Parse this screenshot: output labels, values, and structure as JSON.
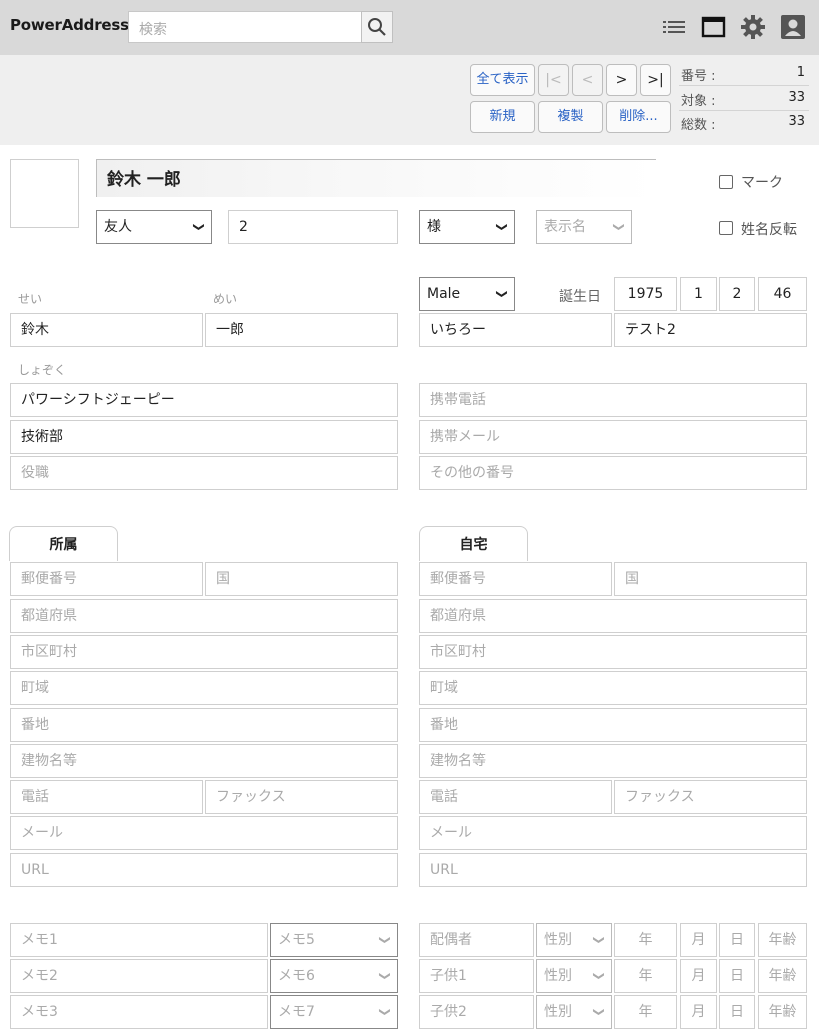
{
  "header": {
    "app_name": "PowerAddress",
    "search_placeholder": "検索"
  },
  "toolbar": {
    "show_all": "全て表示",
    "first": "|<",
    "prev": "<",
    "next": ">",
    "last": ">|",
    "new": "新規",
    "duplicate": "複製",
    "delete": "削除...",
    "stats": [
      {
        "label": "番号 :",
        "value": "1"
      },
      {
        "label": "対象 :",
        "value": "33"
      },
      {
        "label": "総数 :",
        "value": "33"
      }
    ]
  },
  "record": {
    "full_name": "鈴木 一郎",
    "mark_label": "マーク",
    "name_reverse_label": "姓名反転",
    "category": "友人",
    "number_value": "2",
    "honorific": "様",
    "display_name_placeholder": "表示名",
    "sei_caption": "せい",
    "mei_caption": "めい",
    "sei": "鈴木",
    "mei": "一郎",
    "gender": "Male",
    "birthday_label": "誕生日",
    "birth_year": "1975",
    "birth_month": "1",
    "birth_day": "2",
    "age": "46",
    "nickname": "いちろー",
    "extra": "テスト2",
    "affiliation_caption": "しょぞく",
    "company": "パワーシフトジェーピー",
    "department": "技術部",
    "title_placeholder": "役職",
    "mobile_phone_placeholder": "携帯電話",
    "mobile_mail_placeholder": "携帯メール",
    "other_number_placeholder": "その他の番号"
  },
  "tabs": {
    "work": "所属",
    "home": "自宅"
  },
  "address_fields": {
    "postal": "郵便番号",
    "country": "国",
    "prefecture": "都道府県",
    "city": "市区町村",
    "town": "町域",
    "street": "番地",
    "building": "建物名等",
    "phone": "電話",
    "fax": "ファックス",
    "mail": "メール",
    "url": "URL"
  },
  "memo": {
    "memo1": "メモ1",
    "memo2": "メモ2",
    "memo3": "メモ3",
    "memo5": "メモ5",
    "memo6": "メモ6",
    "memo7": "メモ7"
  },
  "family": {
    "spouse": "配偶者",
    "child1": "子供1",
    "child2": "子供2",
    "gender": "性別",
    "year": "年",
    "month": "月",
    "day": "日",
    "age": "年齢"
  }
}
